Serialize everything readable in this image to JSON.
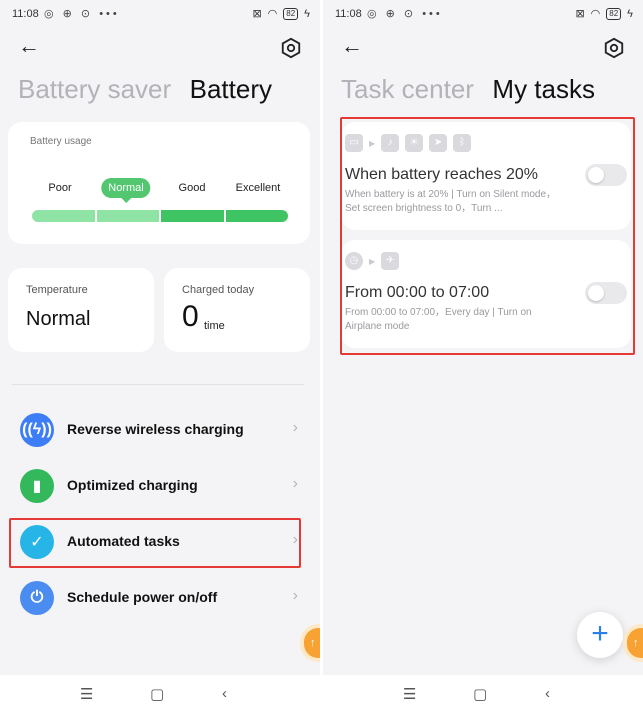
{
  "status": {
    "time": "11:08",
    "icons_left": "◎ ⊕ ⊙ •••",
    "battery": "82"
  },
  "left": {
    "tabs": [
      {
        "label": "Battery saver"
      },
      {
        "label": "Battery"
      }
    ],
    "usage": {
      "title": "Battery usage",
      "levels": [
        "Poor",
        "Normal",
        "Good",
        "Excellent"
      ],
      "selected": "Normal"
    },
    "temperature": {
      "label": "Temperature",
      "value": "Normal"
    },
    "charged": {
      "label": "Charged today",
      "value": "0",
      "unit": "time"
    },
    "menu": [
      {
        "label": "Reverse wireless charging",
        "icon": "wireless-charging-icon",
        "color": "#3d7df5"
      },
      {
        "label": "Optimized charging",
        "icon": "battery-shield-icon",
        "color": "#33b85c"
      },
      {
        "label": "Automated tasks",
        "icon": "clipboard-check-icon",
        "color": "#27b5e8"
      },
      {
        "label": "Schedule power on/off",
        "icon": "power-icon",
        "color": "#4a8cf0"
      }
    ]
  },
  "right": {
    "tabs": [
      {
        "label": "Task center"
      },
      {
        "label": "My tasks"
      }
    ],
    "tasks": [
      {
        "title": "When battery reaches 20%",
        "description": "When battery is at 20% | Turn on Silent mode，Set screen brightness to 0，Turn ...",
        "enabled": false
      },
      {
        "title": "From 00:00 to 07:00",
        "description": "From 00:00 to 07:00，Every day | Turn on Airplane mode",
        "enabled": false
      }
    ]
  },
  "colors": {
    "accent_green": "#3fc463",
    "highlight_red": "#e53935",
    "fab_blue": "#2a7fe8"
  }
}
